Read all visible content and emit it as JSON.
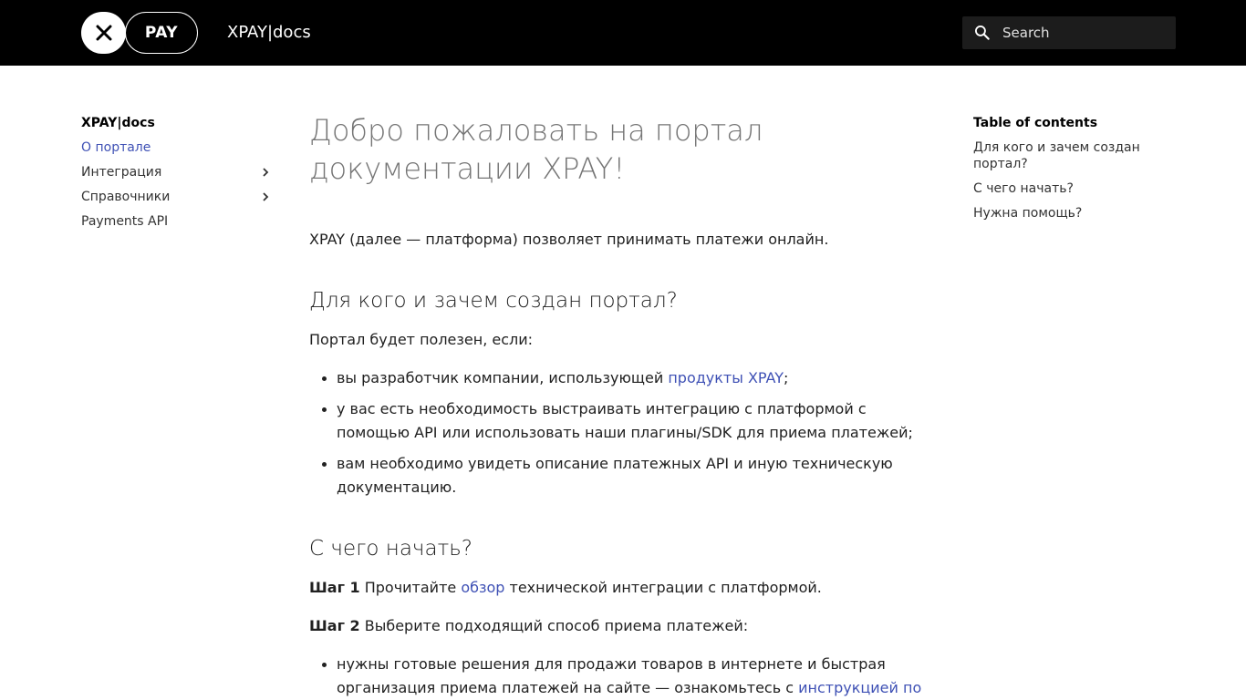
{
  "header": {
    "logo_x": "✕",
    "logo_pay": "PAY",
    "site_title": "XPAY|docs",
    "search_placeholder": "Search",
    "search_icon": "search-icon"
  },
  "nav": {
    "title": "XPAY|docs",
    "items": [
      {
        "label": "О портале",
        "active": true,
        "expandable": false
      },
      {
        "label": "Интеграция",
        "active": false,
        "expandable": true
      },
      {
        "label": "Справочники",
        "active": false,
        "expandable": true
      },
      {
        "label": "Payments API",
        "active": false,
        "expandable": false
      }
    ]
  },
  "main": {
    "title": "Добро пожаловать на портал документации XPAY!",
    "intro": "XPAY (далее — платформа) позволяет принимать платежи онлайн.",
    "section1": {
      "heading": "Для кого и зачем создан портал?",
      "lead": "Портал будет полезен, если:",
      "bullet1_text": "вы разработчик компании, использующей ",
      "bullet1_link": "продукты XPAY",
      "bullet1_tail": ";",
      "bullet2": "у вас есть необходимость выстраивать интеграцию с платформой с помощью API или использовать наши плагины/SDK для приема платежей;",
      "bullet3": "вам необходимо увидеть описание платежных API и иную техническую документацию."
    },
    "section2": {
      "heading": "С чего начать?",
      "step1_label": "Шаг 1",
      "step1_text": " Прочитайте ",
      "step1_link": "обзор",
      "step1_tail": " технической интеграции с платформой.",
      "step2_label": "Шаг 2",
      "step2_text": " Выберите подходящий способ приема платежей:",
      "bullet1_text": "нужны готовые решения для продажи товаров в интернете и быстрая организация приема платежей на сайте — ознакомьтесь с ",
      "bullet1_link": "инструкцией по"
    }
  },
  "toc": {
    "title": "Table of contents",
    "items": [
      "Для кого и зачем создан портал?",
      "С чего начать?",
      "Нужна помощь?"
    ]
  },
  "colors": {
    "header_bg": "#000000",
    "link": "#3f51b5",
    "title_gray": "#757575"
  }
}
